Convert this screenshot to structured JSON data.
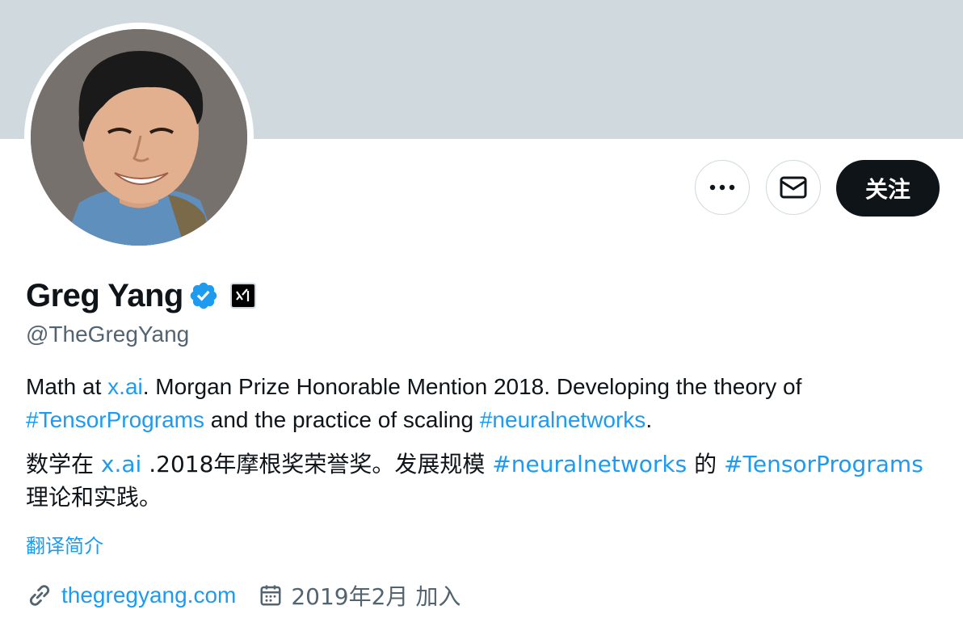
{
  "profile": {
    "display_name": "Greg Yang",
    "handle": "@TheGregYang",
    "verified_icon": "verified-badge-icon",
    "org_badge_icon": "xai-logo-icon"
  },
  "actions": {
    "more_icon": "more-icon",
    "message_icon": "mail-icon",
    "follow_label": "关注"
  },
  "bio": {
    "en": {
      "t1": "Math at ",
      "link1": "x.ai",
      "t2": ". Morgan Prize Honorable Mention 2018. Developing the theory of ",
      "link2": "#TensorPrograms",
      "t3": " and the practice of scaling ",
      "link3": "#neuralnetworks",
      "t4": "."
    },
    "zh": {
      "t1": "数学在 ",
      "link1": "x.ai",
      "t2": " .2018年摩根奖荣誉奖。发展规模 ",
      "link2": "#neuralnetworks",
      "t3": " 的 ",
      "link3": "#TensorPrograms",
      "t4": " 理论和实践。"
    },
    "translate_label": "翻译简介"
  },
  "meta": {
    "website": "thegregyang.com",
    "website_icon": "link-icon",
    "joined": "2019年2月 加入",
    "joined_icon": "calendar-icon"
  },
  "colors": {
    "banner": "#cfd9de",
    "link": "#1d9bf0",
    "follow_bg": "#0f1419",
    "secondary_text": "#536471"
  }
}
